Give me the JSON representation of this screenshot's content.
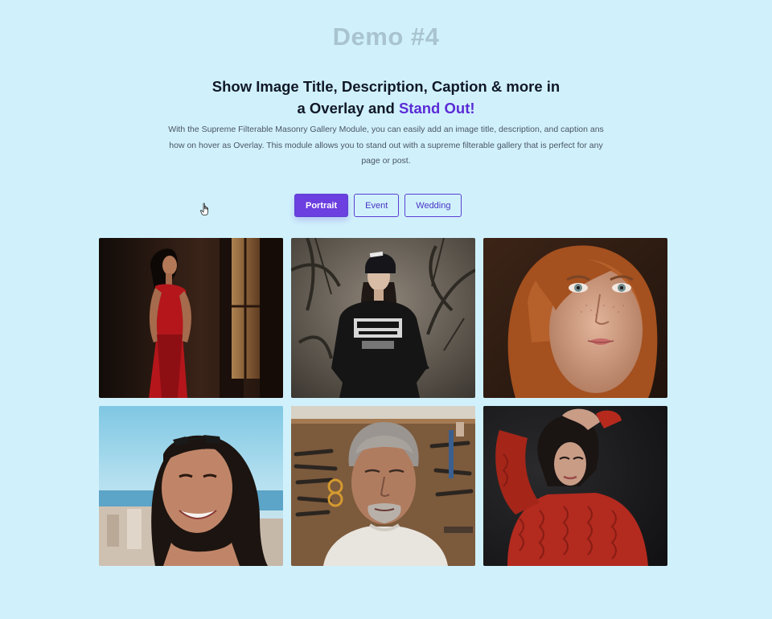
{
  "demo": {
    "title": "Demo #4"
  },
  "headline": {
    "line1": "Show Image Title, Description, Caption & more in",
    "line2_prefix": "a Overlay and ",
    "line2_accent": "Stand Out!"
  },
  "description": "With the Supreme Filterable Masonry Gallery Module, you can easily add an image title, description, and caption ans how on hover as Overlay. This module allows you to stand out with a supreme filterable gallery that is perfect for any page or post.",
  "filters": [
    {
      "label": "Portrait",
      "active": true
    },
    {
      "label": "Event",
      "active": false
    },
    {
      "label": "Wedding",
      "active": false
    }
  ],
  "colors": {
    "background": "#d0f1fc",
    "accent": "#5b2bd6",
    "active_button": "#6b3fe0",
    "demo_title": "#a9c4cf"
  },
  "gallery": {
    "images": [
      {
        "subject": "woman-red-dress-window"
      },
      {
        "subject": "woman-black-beanie-sweatshirt"
      },
      {
        "subject": "woman-freckles-closeup"
      },
      {
        "subject": "woman-smiling-sunglasses-beach"
      },
      {
        "subject": "older-man-workshop-tools"
      },
      {
        "subject": "woman-red-knit-sweater"
      }
    ]
  },
  "cursor": {
    "icon": "pointer-hand-icon"
  }
}
